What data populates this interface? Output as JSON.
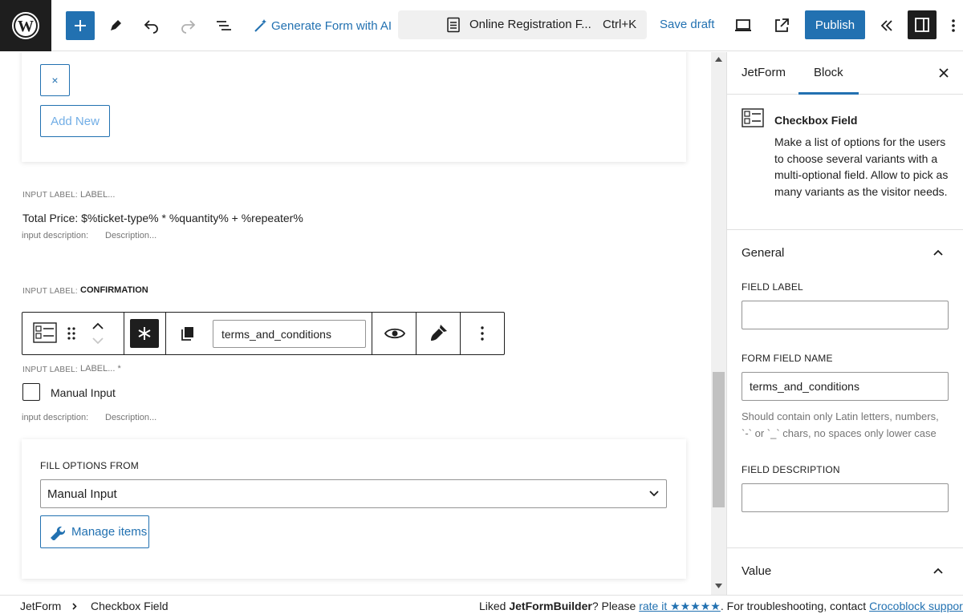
{
  "topbar": {
    "generate_ai_label": "Generate Form with AI",
    "command_title": "Online Registration F...",
    "command_shortcut": "Ctrl+K",
    "save_draft_label": "Save draft",
    "publish_label": "Publish",
    "icons": [
      "wordpress-logo-icon",
      "plus-icon",
      "pen-icon",
      "undo-icon",
      "redo-icon",
      "list-view-icon",
      "magic-wand-icon",
      "document-icon",
      "desktop-preview-icon",
      "external-link-icon",
      "collapse-icon",
      "sidebar-icon",
      "more-vertical-icon"
    ]
  },
  "canvas": {
    "remove_button_label": "×",
    "add_new_label": "Add New",
    "price_field": {
      "input_label_caption": "INPUT LABEL:",
      "input_label_value": "LABEL...",
      "text": "Total Price: $%ticket-type% * %quantity% + %repeater%",
      "description_caption": "input description:",
      "description_value": "Description..."
    },
    "confirmation_field": {
      "input_label_caption": "INPUT LABEL:",
      "input_label_value": "CONFIRMATION"
    },
    "block_toolbar": {
      "field_name": "terms_and_conditions"
    },
    "checkbox_field": {
      "input_label_caption": "INPUT LABEL:",
      "input_label_value": "LABEL... *",
      "option_label": "Manual Input",
      "description_caption": "input description:",
      "description_value": "Description..."
    },
    "fill_options": {
      "label": "FILL OPTIONS FROM",
      "selected": "Manual Input",
      "manage_label": "Manage items"
    }
  },
  "sidebar": {
    "tabs": [
      "JetForm",
      "Block"
    ],
    "active_tab": "Block",
    "block_name": "Checkbox Field",
    "block_description": "Make a list of options for the users to choose several variants with a multi-optional field. Allow to pick as many variants as the visitor needs.",
    "general_title": "General",
    "field_label_title": "FIELD LABEL",
    "field_label_value": "",
    "form_field_name_title": "FORM FIELD NAME",
    "form_field_name_value": "terms_and_conditions",
    "form_field_help": "Should contain only Latin letters, numbers, `-` or `_` chars, no spaces only lower case",
    "field_description_title": "FIELD DESCRIPTION",
    "field_description_value": "",
    "value_title": "Value"
  },
  "footer": {
    "breadcrumb": [
      "JetForm",
      "Checkbox Field"
    ],
    "msg_prefix": "Liked ",
    "msg_brand": "JetFormBuilder",
    "msg_mid": "? Please ",
    "msg_rate": "rate it ★★★★★",
    "msg_suffix": ". For troubleshooting, contact ",
    "msg_link": "Crocoblock support"
  },
  "colors": {
    "accent": "#2271b1",
    "dark": "#1e1e1e",
    "muted": "#757575"
  }
}
